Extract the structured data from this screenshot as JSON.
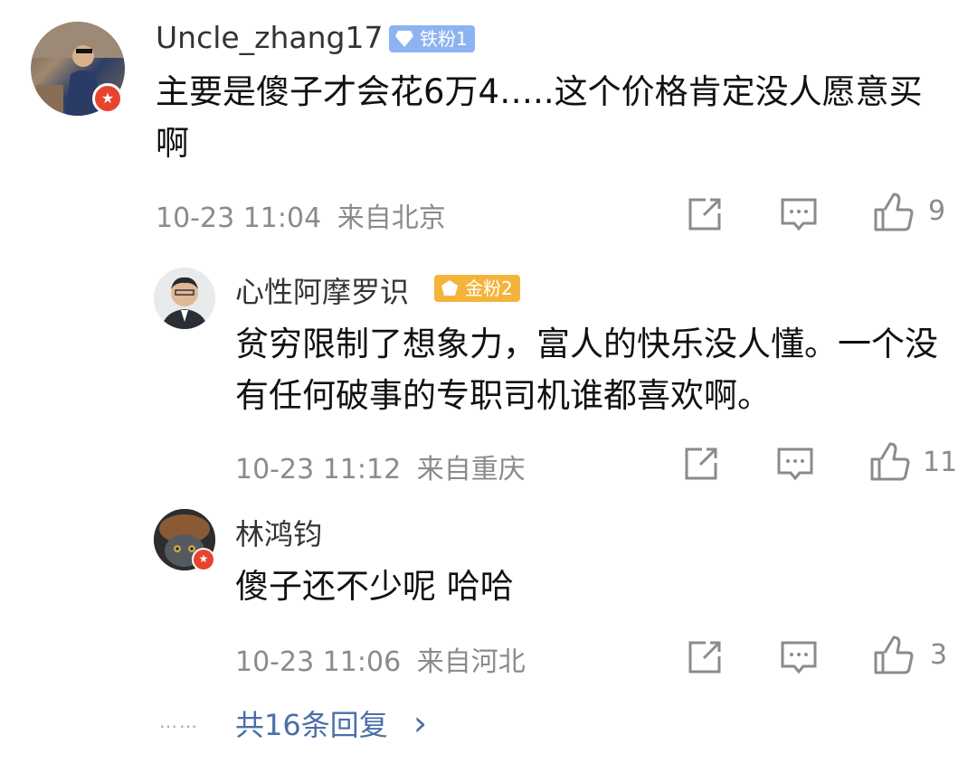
{
  "comment": {
    "username": "Uncle_zhang17",
    "badge": "铁粉1",
    "text": "主要是傻子才会花6万4…..这个价格肯定没人愿意买啊",
    "time": "10-23 11:04",
    "location": "来自北京",
    "likes": "9",
    "icons": [
      "share-icon",
      "comment-icon",
      "like-icon"
    ]
  },
  "replies": [
    {
      "username": "心性阿摩罗识",
      "badge": "金粉2",
      "text": "贫穷限制了想象力，富人的快乐没人懂。一个没有任何破事的专职司机谁都喜欢啊。",
      "time": "10-23 11:12",
      "location": "来自重庆",
      "likes": "11"
    },
    {
      "username": "林鸿钧",
      "badge": "",
      "text": "傻子还不少呢 哈哈",
      "time": "10-23 11:06",
      "location": "来自河北",
      "likes": "3"
    }
  ],
  "more": {
    "dots": "……",
    "label": "共16条回复",
    "chevron": "›"
  },
  "colors": {
    "iron_badge": "#8db4f0",
    "gold_badge": "#f4b43c",
    "verified": "#e8432f",
    "link": "#4a6fa8",
    "meta": "#8b8b8b"
  }
}
